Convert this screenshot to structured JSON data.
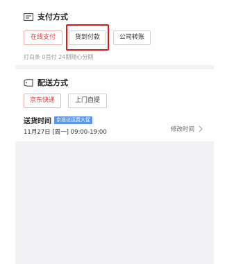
{
  "payment": {
    "title": "支付方式",
    "options": [
      {
        "label": "在线支付"
      },
      {
        "label": "货到付款"
      },
      {
        "label": "公司转账"
      }
    ],
    "installment_note": "打白条 0首付 24期随心分期"
  },
  "shipping": {
    "title": "配送方式",
    "options": [
      {
        "label": "京东快递"
      },
      {
        "label": "上门自提"
      }
    ],
    "delivery_time_label": "送货时间",
    "promo_badge": "京准达运费大促",
    "delivery_time_value": "11月27日 [周一] 09:00-19:00",
    "modify_label": "修改时间"
  },
  "colors": {
    "accent": "#e4393c",
    "highlight": "#e01818",
    "badge": "#5b95e6",
    "panel_bg": "#f2f2f4"
  }
}
